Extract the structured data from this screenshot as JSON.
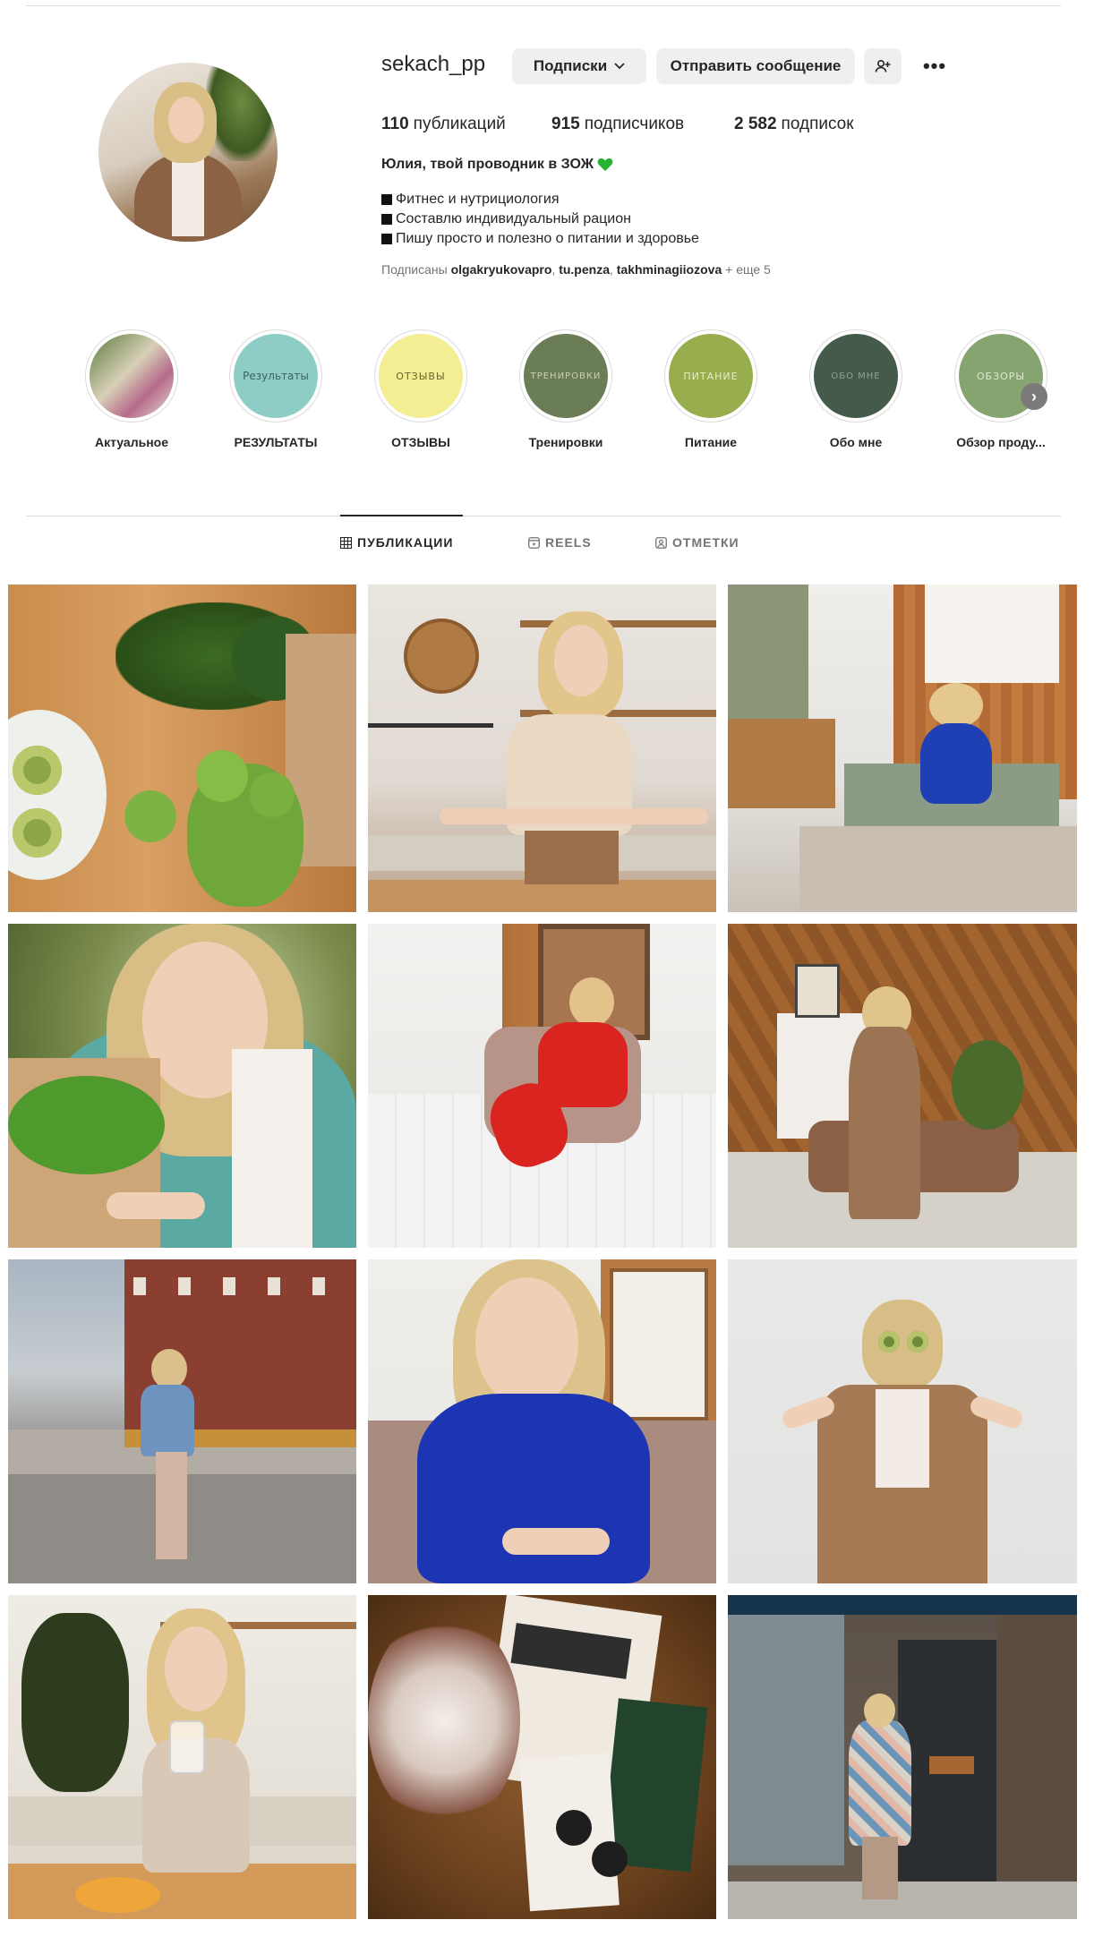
{
  "profile": {
    "username": "sekach_pp",
    "follow_button": "Подписки",
    "message_button": "Отправить сообщение",
    "posts_count": "110",
    "posts_label": "публикаций",
    "followers_count": "915",
    "followers_label": "подписчиков",
    "following_count": "2 582",
    "following_label": "подписок",
    "bio_name": "Юлия, твой проводник в ЗОЖ",
    "bio_lines": [
      "Фитнес и нутрициология",
      "Составлю индивидуальный рацион",
      "Пишу просто и полезно о питании и здоровье"
    ],
    "followed_by_prefix": "Подписаны",
    "followed_by_accounts": [
      "olgakryukovapro",
      "tu.penza",
      "takhminagiiozova"
    ],
    "followed_by_more": "+ еще 5"
  },
  "highlights": [
    {
      "label": "Актуальное",
      "cover_text": "",
      "color": "#c9b79a"
    },
    {
      "label": "РЕЗУЛЬТАТЫ",
      "cover_text": "Результаты",
      "color": "#8ecdc6"
    },
    {
      "label": "ОТЗЫВЫ",
      "cover_text": "ОТЗЫВЫ",
      "color": "#f3ee93"
    },
    {
      "label": "Тренировки",
      "cover_text": "ТРЕНИРОВКИ",
      "color": "#6b7d56"
    },
    {
      "label": "Питание",
      "cover_text": "ПИТАНИЕ",
      "color": "#98ad4d"
    },
    {
      "label": "Обо мне",
      "cover_text": "ОБО МНЕ",
      "color": "#445a4b"
    },
    {
      "label": "Обзор проду...",
      "cover_text": "ОБЗОРЫ",
      "color": "#86a46f"
    }
  ],
  "tabs": {
    "posts": "ПУБЛИКАЦИИ",
    "reels": "REELS",
    "tagged": "ОТМЕТКИ"
  },
  "icons": [
    "chevron-down-icon",
    "add-person-icon",
    "more-icon",
    "grid-icon",
    "reels-icon",
    "tagged-icon",
    "chevron-right-icon",
    "green-heart-icon"
  ]
}
